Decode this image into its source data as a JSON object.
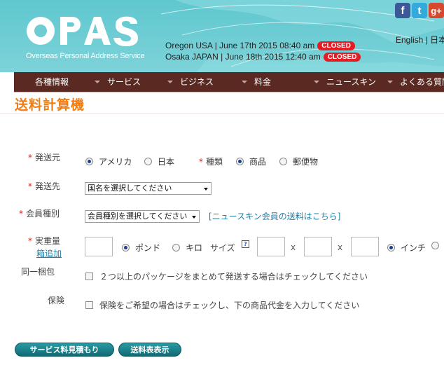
{
  "header": {
    "logo_name": "OPAS",
    "logo_subtitle": "Overseas Personal Address Service",
    "clocks": [
      {
        "text": "Oregon USA   | June 17th 2015 08:40 am",
        "status": "CLOSED"
      },
      {
        "text": "Osaka JAPAN | June 18th 2015 12:40 am",
        "status": "CLOSED"
      }
    ],
    "social": [
      {
        "icon": "facebook-icon",
        "glyph": "f",
        "color": "#3b5998"
      },
      {
        "icon": "twitter-icon",
        "glyph": "t",
        "color": "#33aadd"
      },
      {
        "icon": "google-plus-icon",
        "glyph": "g+",
        "color": "#d6492f"
      }
    ],
    "language": "English | 日本"
  },
  "nav": {
    "items": [
      "各種情報",
      "サービス",
      "ビジネス",
      "料金",
      "ニュースキン",
      "よくある質問"
    ]
  },
  "page": {
    "title": "送料計算機"
  },
  "form": {
    "origin_label": "発送元",
    "origin_options": [
      "アメリカ",
      "日本"
    ],
    "origin_selected": "アメリカ",
    "type_label": "種類",
    "type_options": [
      "商品",
      "郵便物"
    ],
    "type_selected": "商品",
    "destination_label": "発送先",
    "destination_select": "国名を選択してください",
    "member_label": "会員種別",
    "member_select": "会員種別を選択してください",
    "nuskin_link": "[ニュースキン会員の送料はこちら]",
    "weight_label": "実重量",
    "add_box_link": "箱追加",
    "weight_units": [
      "ポンド",
      "キロ"
    ],
    "weight_unit_selected": "ポンド",
    "size_label": "サイズ",
    "size_help": "?",
    "size_separator": "x",
    "size_units": [
      "インチ",
      ""
    ],
    "size_unit_selected": "インチ",
    "consolidate_label": "同一梱包",
    "consolidate_text": "２つ以上のパッケージをまとめて発送する場合はチェックしてください",
    "insurance_label": "保険",
    "insurance_text": "保険をご希望の場合はチェックし、下の商品代金を入力してください",
    "required_mark": "*"
  },
  "buttons": {
    "estimate": "サービス料見積もり",
    "rate_table": "送料表表示"
  },
  "colors": {
    "header_bg": "#6dcdd3",
    "nav_bg": "#5a2a22",
    "title": "#f07e16",
    "closed_badge": "#e51c23",
    "button": "#1a7f88",
    "link": "#1f7fa8"
  }
}
